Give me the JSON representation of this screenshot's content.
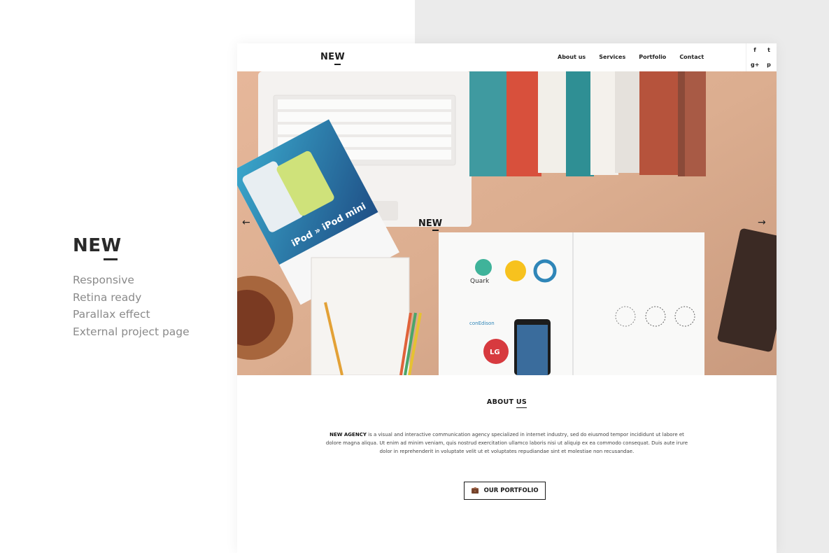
{
  "promo": {
    "logo": "NEW",
    "features": [
      "Responsive",
      "Retina ready",
      "Parallax effect",
      "External project page"
    ]
  },
  "site": {
    "logo": "NEW",
    "nav": [
      "About us",
      "Services",
      "Portfolio",
      "Contact"
    ],
    "social": [
      {
        "icon": "facebook-icon",
        "glyph": "f"
      },
      {
        "icon": "twitter-icon",
        "glyph": "t"
      },
      {
        "icon": "google-plus-icon",
        "glyph": "g+"
      },
      {
        "icon": "pinterest-icon",
        "glyph": "p"
      }
    ],
    "hero": {
      "logo": "NEW",
      "prev_arrow": "←",
      "next_arrow": "→",
      "magazine_title": "iPod » iPod mini",
      "logo_names": [
        "Quark",
        "conEdison",
        "LG"
      ]
    },
    "about": {
      "title_prefix": "ABOUT ",
      "title_suffix": "US",
      "lead": "NEW AGENCY",
      "body": " is a visual and interactive communication agency specialized in internet industry, sed do eiusmod tempor incididunt ut labore et dolore magna aliqua. Ut enim ad minim veniam, quis nostrud exercitation ullamco laboris nisi ut aliquip ex ea commodo consequat. Duis aute irure dolor in reprehenderit in voluptate velit ut et voluptates repudiandae sint et molestiae non recusandae.",
      "button_label": "OUR PORTFOLIO",
      "button_icon": "briefcase-icon"
    }
  },
  "colors": {
    "dark": "#1a1a1a",
    "muted": "#8a8a8a",
    "right_bg": "#ebebeb",
    "hero_wood": "#d9a98a"
  }
}
